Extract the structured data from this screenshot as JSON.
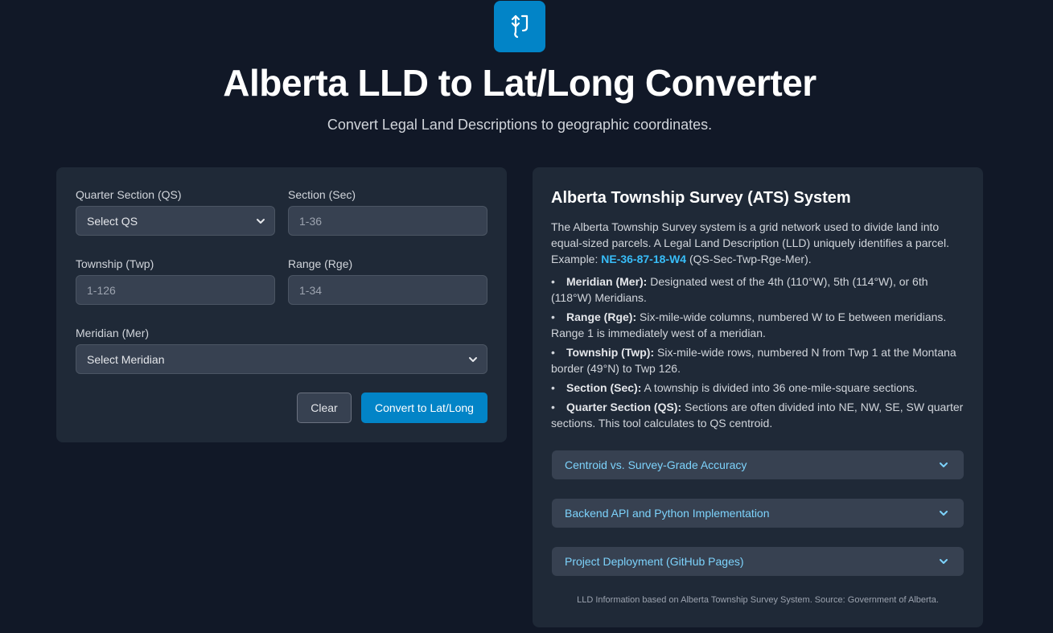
{
  "header": {
    "logo_icon": "arrows-vertical-icon",
    "title": "Alberta LLD to Lat/Long Converter",
    "subtitle": "Convert Legal Land Descriptions to geographic coordinates."
  },
  "form": {
    "qs": {
      "label": "Quarter Section (QS)",
      "value": "Select QS"
    },
    "sec": {
      "label": "Section (Sec)",
      "placeholder": "1-36"
    },
    "twp": {
      "label": "Township (Twp)",
      "placeholder": "1-126"
    },
    "rge": {
      "label": "Range (Rge)",
      "placeholder": "1-34"
    },
    "mer": {
      "label": "Meridian (Mer)",
      "value": "Select Meridian"
    },
    "clear_label": "Clear",
    "convert_label": "Convert to Lat/Long"
  },
  "info": {
    "title": "Alberta Township Survey (ATS) System",
    "intro": "The Alberta Township Survey system is a grid network used to divide land into equal-sized parcels. A Legal Land Description (LLD) uniquely identifies a parcel. Example:",
    "example": "NE-36-87-18-W4",
    "example_suffix": " (QS-Sec-Twp-Rge-Mer).",
    "items": [
      {
        "term": "Meridian (Mer):",
        "text": " Designated west of the 4th (110°W), 5th (114°W), or 6th (118°W) Meridians."
      },
      {
        "term": "Range (Rge):",
        "text": " Six-mile-wide columns, numbered W to E between meridians. Range 1 is immediately west of a meridian."
      },
      {
        "term": "Township (Twp):",
        "text": " Six-mile-wide rows, numbered N from Twp 1 at the Montana border (49°N) to Twp 126."
      },
      {
        "term": "Section (Sec):",
        "text": " A township is divided into 36 one-mile-square sections."
      },
      {
        "term": "Quarter Section (QS):",
        "text": " Sections are often divided into NE, NW, SE, SW quarter sections. This tool calculates to QS centroid."
      }
    ],
    "accordions": [
      "Centroid vs. Survey-Grade Accuracy",
      "Backend API and Python Implementation",
      "Project Deployment (GitHub Pages)"
    ],
    "footnote": "LLD Information based on Alberta Township Survey System. Source: Government of Alberta."
  }
}
